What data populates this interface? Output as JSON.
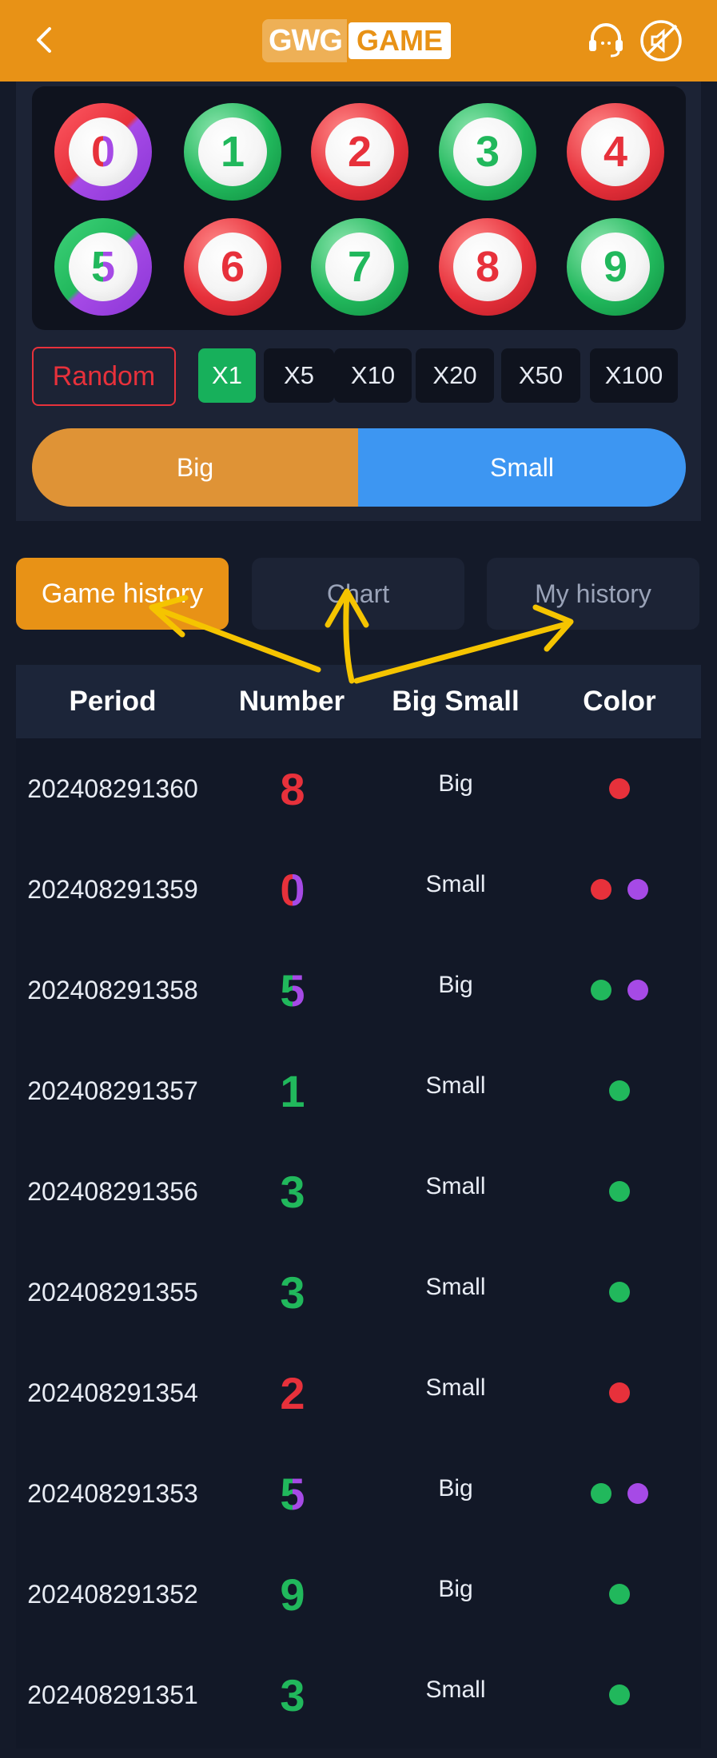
{
  "header": {
    "logo_mark": "GWG",
    "logo_word": "GAME",
    "icons": [
      "back-arrow-icon",
      "headset-icon",
      "sound-off-icon"
    ]
  },
  "balls": [
    {
      "number": "0",
      "color": "red-violet"
    },
    {
      "number": "1",
      "color": "green"
    },
    {
      "number": "2",
      "color": "red"
    },
    {
      "number": "3",
      "color": "green"
    },
    {
      "number": "4",
      "color": "red"
    },
    {
      "number": "5",
      "color": "green-violet"
    },
    {
      "number": "6",
      "color": "red"
    },
    {
      "number": "7",
      "color": "green"
    },
    {
      "number": "8",
      "color": "red"
    },
    {
      "number": "9",
      "color": "green"
    }
  ],
  "controls": {
    "random_label": "Random",
    "multipliers": [
      "X1",
      "X5",
      "X10",
      "X20",
      "X50",
      "X100"
    ],
    "selected_multiplier": "X1",
    "big_label": "Big",
    "small_label": "Small"
  },
  "tabs": [
    {
      "label": "Game history",
      "active": true
    },
    {
      "label": "Chart",
      "active": false
    },
    {
      "label": "My history",
      "active": false
    }
  ],
  "table": {
    "headers": [
      "Period",
      "Number",
      "Big Small",
      "Color"
    ],
    "rows": [
      {
        "period": "202408291360",
        "number": "8",
        "number_color": "red",
        "big_small": "Big",
        "colors": [
          "red"
        ]
      },
      {
        "period": "202408291359",
        "number": "0",
        "number_color": "red-violet",
        "big_small": "Small",
        "colors": [
          "red",
          "violet"
        ]
      },
      {
        "period": "202408291358",
        "number": "5",
        "number_color": "green-violet",
        "big_small": "Big",
        "colors": [
          "green",
          "violet"
        ]
      },
      {
        "period": "202408291357",
        "number": "1",
        "number_color": "green",
        "big_small": "Small",
        "colors": [
          "green"
        ]
      },
      {
        "period": "202408291356",
        "number": "3",
        "number_color": "green",
        "big_small": "Small",
        "colors": [
          "green"
        ]
      },
      {
        "period": "202408291355",
        "number": "3",
        "number_color": "green",
        "big_small": "Small",
        "colors": [
          "green"
        ]
      },
      {
        "period": "202408291354",
        "number": "2",
        "number_color": "red",
        "big_small": "Small",
        "colors": [
          "red"
        ]
      },
      {
        "period": "202408291353",
        "number": "5",
        "number_color": "green-violet",
        "big_small": "Big",
        "colors": [
          "green",
          "violet"
        ]
      },
      {
        "period": "202408291352",
        "number": "9",
        "number_color": "green",
        "big_small": "Big",
        "colors": [
          "green"
        ]
      },
      {
        "period": "202408291351",
        "number": "3",
        "number_color": "green",
        "big_small": "Small",
        "colors": [
          "green"
        ]
      }
    ]
  },
  "colors": {
    "brand_orange": "#e89216",
    "red": "#e7313b",
    "green": "#21b85c",
    "violet": "#a64ae6",
    "blue": "#3d96f2",
    "annotation_yellow": "#f5c400"
  }
}
